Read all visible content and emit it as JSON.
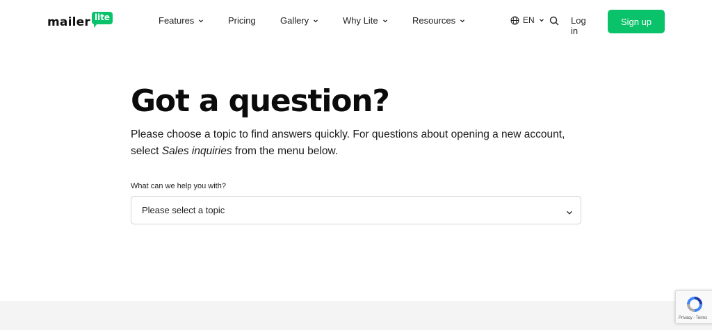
{
  "brand": {
    "wordmark": "mailer",
    "badge": "lite",
    "accent_color": "#09c269"
  },
  "nav": {
    "items": [
      {
        "label": "Features",
        "has_dropdown": true
      },
      {
        "label": "Pricing",
        "has_dropdown": false
      },
      {
        "label": "Gallery",
        "has_dropdown": true
      },
      {
        "label": "Why Lite",
        "has_dropdown": true
      },
      {
        "label": "Resources",
        "has_dropdown": true
      }
    ],
    "language": "EN",
    "login_label": "Log in",
    "signup_label": "Sign up"
  },
  "main": {
    "title": "Got a question?",
    "description_part1": "Please choose a topic to find answers quickly. For questions about opening a new account, select ",
    "description_emphasis": "Sales inquiries",
    "description_part2": " from the menu below.",
    "topic_label": "What can we help you with?",
    "topic_select_value": "Please select a topic"
  },
  "recaptcha": {
    "footer_text": "Privacy - Terms"
  }
}
